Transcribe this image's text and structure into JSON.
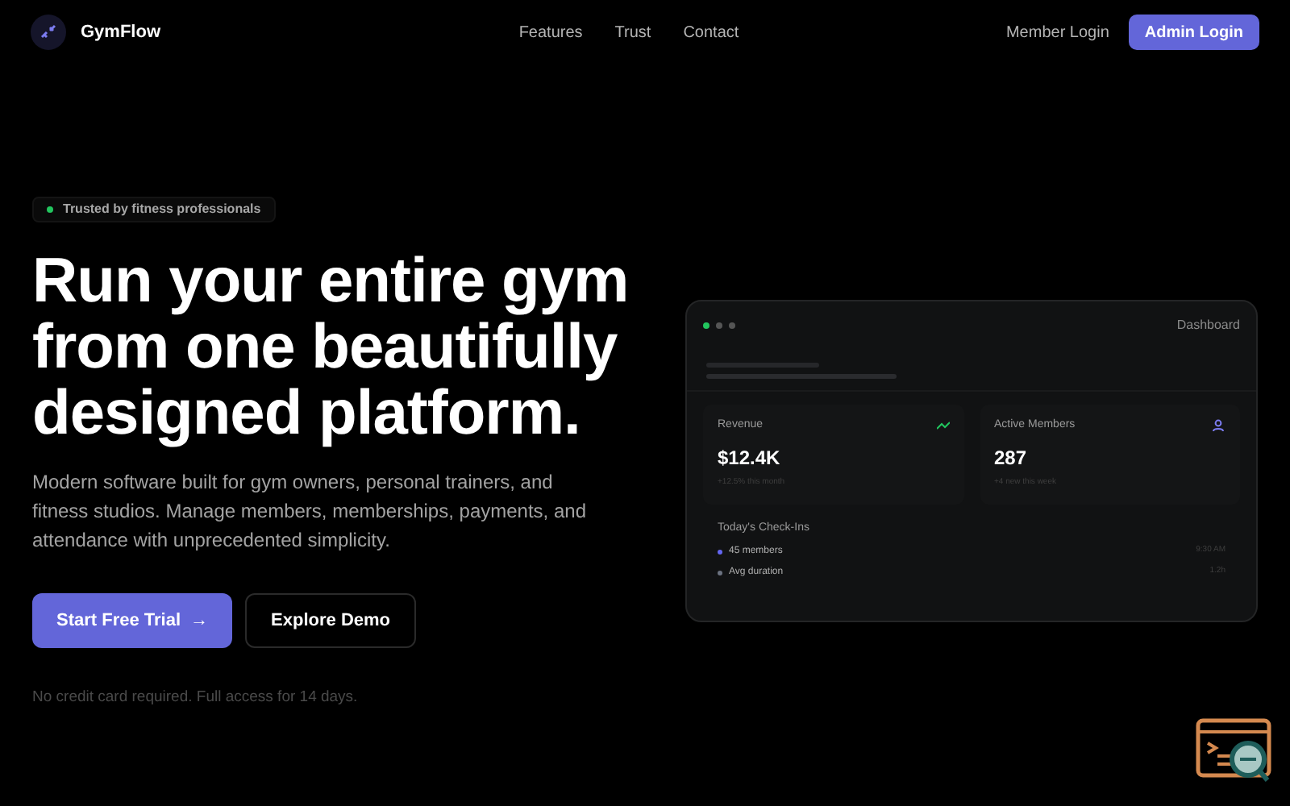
{
  "brand": {
    "name": "GymFlow"
  },
  "nav": {
    "links": [
      "Features",
      "Trust",
      "Contact"
    ],
    "member_login": "Member Login",
    "admin_login": "Admin Login"
  },
  "hero": {
    "badge": "Trusted by fitness professionals",
    "headline": "Run your entire gym from one beautifully designed platform.",
    "description": "Modern software built for gym owners, personal trainers, and fitness studios. Manage members, memberships, payments, and attendance with unprecedented simplicity.",
    "primary_button": "Start Free Trial",
    "primary_arrow": "→",
    "secondary_button": "Explore Demo",
    "note": "No credit card required. Full access for 14 days."
  },
  "dashboard": {
    "title": "Dashboard",
    "stats": [
      {
        "kind": "trend",
        "label": "Revenue",
        "value": "$12.4K",
        "change": "+12.5% this month"
      },
      {
        "kind": "members",
        "label": "Active Members",
        "value": "287",
        "change": "+4 new this week"
      }
    ],
    "checkins": {
      "title": "Today's Check-Ins",
      "rows": [
        {
          "label": "45 members",
          "value": "9:30 AM",
          "color": "#6366f1"
        },
        {
          "label": "Avg duration",
          "value": "1.2h",
          "color": "#6b7280"
        }
      ]
    }
  }
}
